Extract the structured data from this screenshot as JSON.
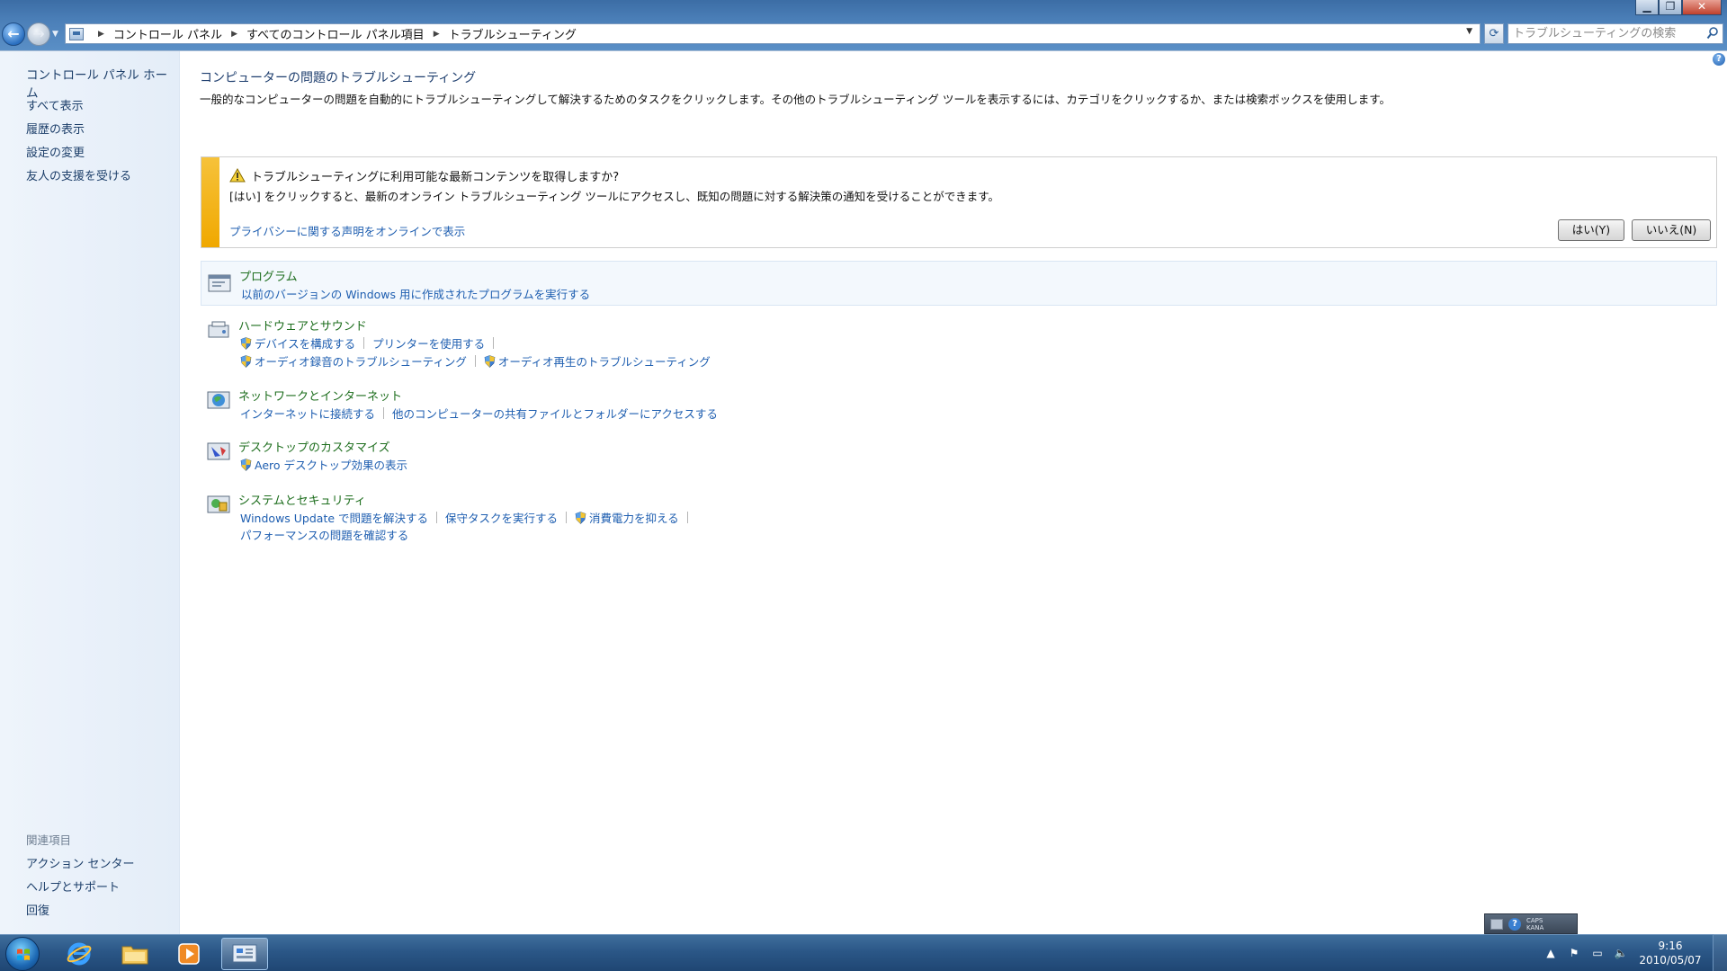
{
  "window": {
    "breadcrumbs": [
      "コントロール パネル",
      "すべてのコントロール パネル項目",
      "トラブルシューティング"
    ],
    "search_placeholder": "トラブルシューティングの検索",
    "minimize": "▁",
    "maximize": "❐",
    "close": "✕"
  },
  "sidebar": {
    "home": "コントロール パネル ホーム",
    "items": [
      "すべて表示",
      "履歴の表示",
      "設定の変更",
      "友人の支援を受ける"
    ],
    "related_heading": "関連項目",
    "related": [
      "アクション センター",
      "ヘルプとサポート",
      "回復"
    ]
  },
  "main": {
    "title": "コンピューターの問題のトラブルシューティング",
    "description": "一般的なコンピューターの問題を自動的にトラブルシューティングして解決するためのタスクをクリックします。その他のトラブルシューティング ツールを表示するには、カテゴリをクリックするか、または検索ボックスを使用します。",
    "banner": {
      "title": "トラブルシューティングに利用可能な最新コンテンツを取得しますか?",
      "text": "[はい] をクリックすると、最新のオンライン トラブルシューティング ツールにアクセスし、既知の問題に対する解決策の通知を受けることができます。",
      "privacy_link": "プライバシーに関する声明をオンラインで表示",
      "yes_button": "はい(Y)",
      "no_button": "いいえ(N)"
    },
    "categories": {
      "programs": {
        "title": "プログラム",
        "tasks": [
          "以前のバージョンの Windows 用に作成されたプログラムを実行する"
        ]
      },
      "hardware": {
        "title": "ハードウェアとサウンド",
        "tasks": [
          "デバイスを構成する",
          "プリンターを使用する",
          "オーディオ録音のトラブルシューティング",
          "オーディオ再生のトラブルシューティング"
        ]
      },
      "network": {
        "title": "ネットワークとインターネット",
        "tasks": [
          "インターネットに接続する",
          "他のコンピューターの共有ファイルとフォルダーにアクセスする"
        ]
      },
      "desktop": {
        "title": "デスクトップのカスタマイズ",
        "tasks": [
          "Aero デスクトップ効果の表示"
        ]
      },
      "system": {
        "title": "システムとセキュリティ",
        "tasks": [
          "Windows Update で問題を解決する",
          "保守タスクを実行する",
          "消費電力を抑える",
          "パフォーマンスの問題を確認する"
        ]
      }
    }
  },
  "taskbar": {
    "langbar_caps": "CAPS",
    "langbar_kana": "KANA",
    "time": "9:16",
    "date": "2010/05/07"
  },
  "colors": {
    "link": "#1e5eb0",
    "category_title": "#1e6e1e",
    "banner_accent": "#f0a800",
    "taskbar": "#2b5787"
  }
}
